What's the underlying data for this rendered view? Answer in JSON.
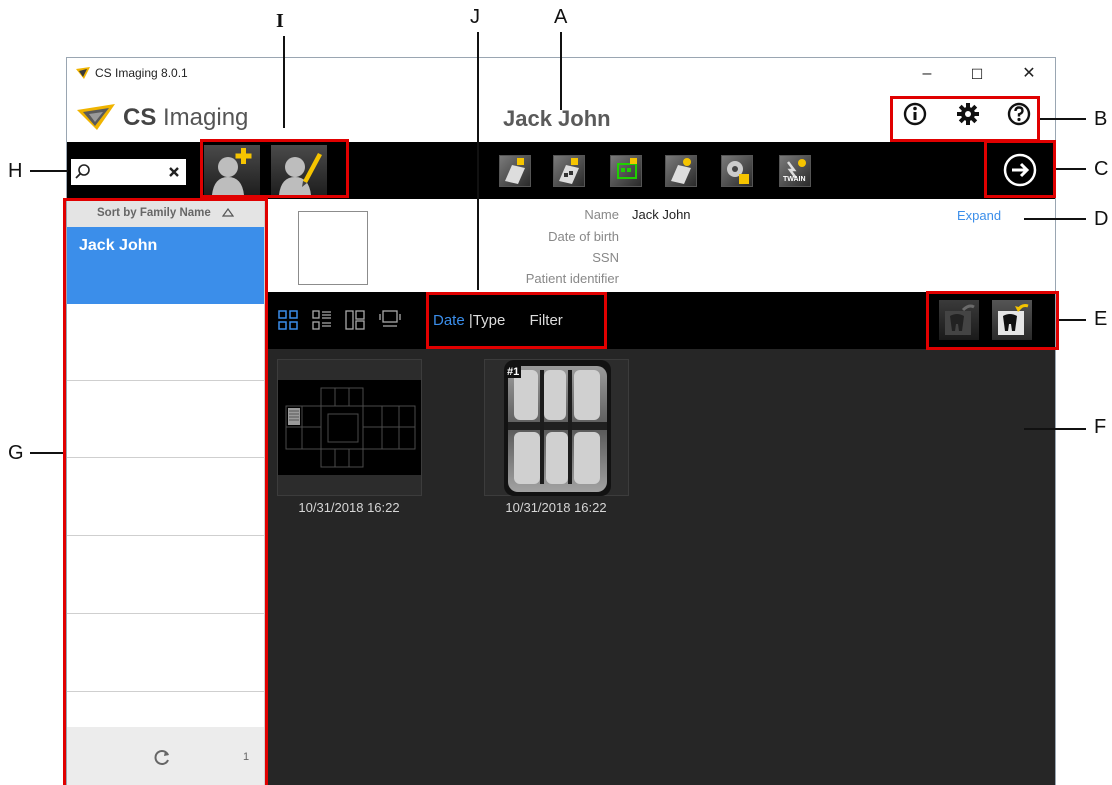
{
  "window": {
    "title": "CS Imaging 8.0.1",
    "minimize": "–",
    "maximize": "☐",
    "close": "✕"
  },
  "header": {
    "brand_bold": "CS",
    "brand_light": " Imaging",
    "patient_name": "Jack John",
    "icons": [
      "info-icon",
      "gear-icon",
      "help-icon"
    ]
  },
  "search": {
    "value": "",
    "placeholder": ""
  },
  "sidebar": {
    "sort_label": "Sort by Family Name",
    "patients": [
      "Jack John"
    ],
    "count": "1"
  },
  "patient_info": {
    "labels": [
      "Name",
      "Date of birth",
      "SSN",
      "Patient identifier"
    ],
    "name_value": "Jack John",
    "expand": "Expand"
  },
  "viewbar": {
    "sort_date": "Date",
    "sort_sep": "|",
    "sort_type": "Type",
    "filter": "Filter"
  },
  "twain_label": "TWAIN",
  "thumbnails": [
    {
      "date": "10/31/2018 16:22",
      "badge": ""
    },
    {
      "date": "10/31/2018 16:22",
      "badge": "#1"
    }
  ],
  "callouts": {
    "A": "A",
    "B": "B",
    "C": "C",
    "D": "D",
    "E": "E",
    "F": "F",
    "G": "G",
    "H": "H",
    "I": "I",
    "J": "J"
  },
  "colors": {
    "accent": "#3b8eea",
    "highlight_red": "#e00000",
    "toolbar_bg": "#000000",
    "content_bg": "#262626"
  }
}
